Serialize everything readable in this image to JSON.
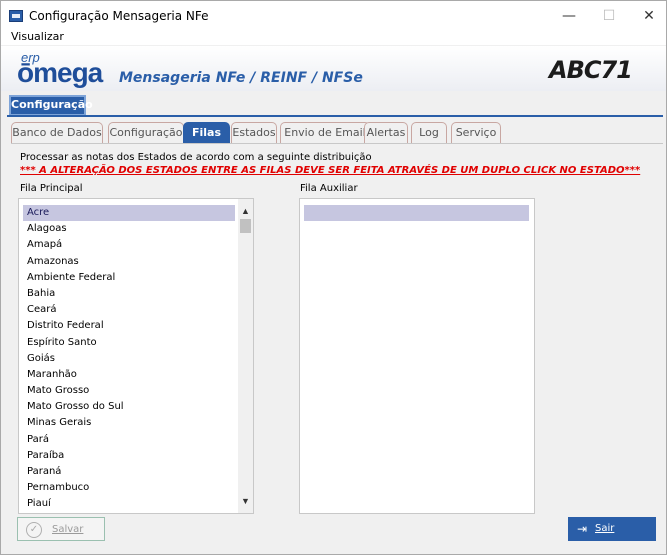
{
  "window": {
    "title": "Configuração Mensageria NFe",
    "icon": "app-window-icon",
    "controls": {
      "minimize": "—",
      "maximize": "☐",
      "close": "✕"
    }
  },
  "menu": {
    "items": [
      "Visualizar"
    ]
  },
  "banner": {
    "logo_top": "erp",
    "logo_main": "ōmega",
    "tagline": "Mensageria NFe / REINF / NFSe",
    "brand": "ABC71"
  },
  "top_tab": {
    "label": "Configuração"
  },
  "tabs": [
    {
      "label": "Banco de Dados",
      "active": false
    },
    {
      "label": "Configuração",
      "active": false
    },
    {
      "label": "Filas",
      "active": true
    },
    {
      "label": "Estados",
      "active": false
    },
    {
      "label": "Envio de Email",
      "active": false
    },
    {
      "label": "Alertas",
      "active": false
    },
    {
      "label": "Log",
      "active": false
    },
    {
      "label": "Serviço",
      "active": false
    }
  ],
  "filas": {
    "info": "Processar as notas dos Estados de acordo com a seguinte distribuição",
    "warning": "*** A ALTERAÇÃO DOS ESTADOS ENTRE AS FILAS DEVE SER FEITA ATRAVÉS DE UM DUPLO CLICK NO ESTADO***",
    "principal_label": "Fila Principal",
    "auxiliar_label": "Fila Auxiliar",
    "principal_items": [
      "Acre",
      "Alagoas",
      "Amapá",
      "Amazonas",
      "Ambiente Federal",
      "Bahia",
      "Ceará",
      "Distrito Federal",
      "Espírito Santo",
      "Goiás",
      "Maranhão",
      "Mato Grosso",
      "Mato Grosso do Sul",
      "Minas Gerais",
      "Pará",
      "Paraíba",
      "Paraná",
      "Pernambuco",
      "Piauí"
    ],
    "principal_selected": "Acre",
    "auxiliar_items": []
  },
  "buttons": {
    "salvar": "Salvar",
    "sair": "Sair"
  },
  "colors": {
    "accent": "#2a5ea8",
    "warning": "#e00000",
    "selection": "#c6c6e0"
  }
}
